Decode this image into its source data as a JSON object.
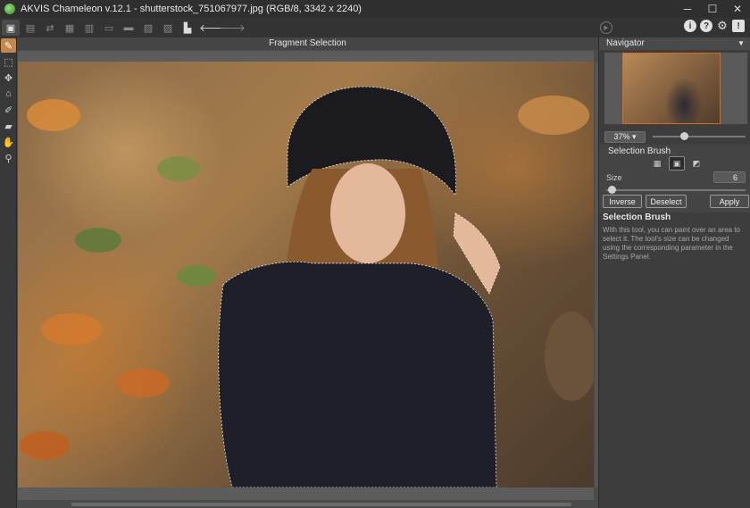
{
  "app": {
    "title": "AKVIS Chameleon v.12.1 - shutterstock_751067977.jpg (RGB/8, 3342 x 2240)"
  },
  "window_controls": {
    "minimize": "─",
    "maximize": "☐",
    "close": "✕"
  },
  "toolbar": {
    "icons": [
      "switch-mode-icon",
      "open-file-icon",
      "save-icon",
      "import-icon",
      "export-icon",
      "print-icon",
      "share-icon",
      "batch-icon",
      "fragment-icon",
      "collage-icon",
      "preferences-icon",
      "undo-icon",
      "redo-icon",
      "run-icon"
    ],
    "right_icons": {
      "info": "i",
      "help": "?",
      "settings": "⚙",
      "notification": "!"
    }
  },
  "tools": [
    "selection-brush-icon",
    "rectangle-select-icon",
    "move-fragment-icon",
    "clone-icon",
    "eraser-icon",
    "smudge-icon",
    "hand-icon",
    "zoom-icon"
  ],
  "canvas": {
    "header": "Fragment Selection"
  },
  "navigator": {
    "title": "Navigator",
    "zoom": "37%",
    "zoom_level": 0.37
  },
  "brush": {
    "title": "Selection Brush",
    "size_label": "Size",
    "size_value": "6"
  },
  "buttons": {
    "inverse": "Inverse",
    "deselect": "Deselect",
    "apply": "Apply"
  },
  "help": {
    "title": "Selection Brush",
    "text": "With this tool, you can paint over an area to select it. The tool's size can be changed using the corresponding parameter in the Settings Panel."
  },
  "colors": {
    "accent": "#d86a1f",
    "active_tool": "#c6884a",
    "panel_bg": "#3d3d3d"
  }
}
